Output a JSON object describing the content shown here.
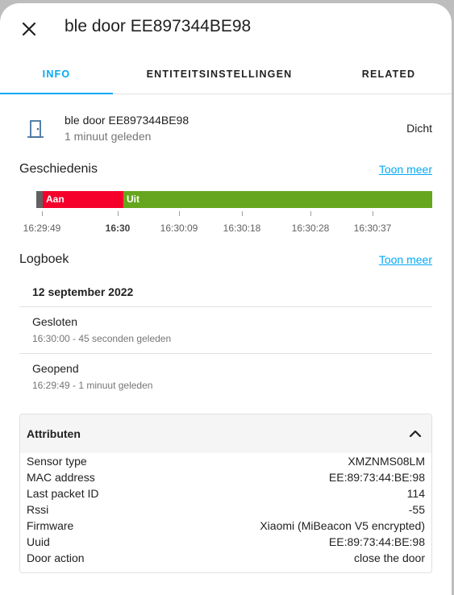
{
  "dialog": {
    "title": "ble door EE897344BE98",
    "close_icon": "close-icon"
  },
  "tabs": [
    {
      "label": "INFO",
      "active": true
    },
    {
      "label": "ENTITEITSINSTELLINGEN",
      "active": false
    },
    {
      "label": "RELATED",
      "active": false
    }
  ],
  "entity": {
    "name": "ble door EE897344BE98",
    "last_changed": "1 minuut geleden",
    "state": "Dicht",
    "icon": "door-icon"
  },
  "history": {
    "title": "Geschiedenis",
    "more_link": "Toon meer",
    "segments": [
      {
        "label": "",
        "color": "#616161"
      },
      {
        "label": "Aan",
        "color": "#f4002a"
      },
      {
        "label": "Uit",
        "color": "#66a61e"
      }
    ],
    "ticks": [
      "16:29:49",
      "16:30",
      "16:30:09",
      "16:30:18",
      "16:30:28",
      "16:30:37"
    ]
  },
  "logbook": {
    "title": "Logboek",
    "more_link": "Toon meer",
    "date": "12 september 2022",
    "entries": [
      {
        "title": "Gesloten",
        "subtitle": "16:30:00 - 45 seconden geleden"
      },
      {
        "title": "Geopend",
        "subtitle": "16:29:49 - 1 minuut geleden"
      }
    ]
  },
  "attributes": {
    "title": "Attributen",
    "rows": [
      {
        "key": "Sensor type",
        "value": "XMZNMS08LM"
      },
      {
        "key": "MAC address",
        "value": "EE:89:73:44:BE:98"
      },
      {
        "key": "Last packet ID",
        "value": "114"
      },
      {
        "key": "Rssi",
        "value": "-55"
      },
      {
        "key": "Firmware",
        "value": "Xiaomi (MiBeacon V5 encrypted)"
      },
      {
        "key": "Uuid",
        "value": "EE:89:73:44:BE:98"
      },
      {
        "key": "Door action",
        "value": "close the door"
      }
    ]
  },
  "colors": {
    "accent": "#03a9f4",
    "on": "#f4002a",
    "off": "#66a61e",
    "unknown": "#616161"
  }
}
